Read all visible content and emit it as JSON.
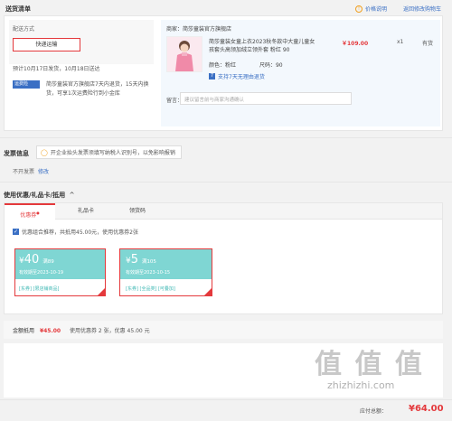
{
  "header": {
    "title": "送货清单",
    "price_help": "价格说明",
    "back_cart": "返回修改购物车"
  },
  "delivery": {
    "label": "配送方式",
    "method_button": "快递运输",
    "schedule": "预计10月17日发货，10月18日送达",
    "badge": "运费险",
    "service_note_line1": "简莎童装官方旗舰店7天内退货，15天内换",
    "service_note_line2": "货，可享1次运费险行到小金库"
  },
  "shop": {
    "label": "商家：简莎童装官方旗舰店",
    "product_name_line1": "简莎童装女童上衣2023秋冬款中大童儿童女",
    "product_name_line2": "孩套头高领加绒立领外套 粉红 90",
    "color_label": "颜色：",
    "color_value": "粉红",
    "size_label": "尺码：",
    "size_value": "90",
    "return_note": "支持7天无理由退货",
    "price": "￥109.00",
    "qty": "x1",
    "stock": "有货",
    "remark_label": "留言：",
    "remark_placeholder": "建议留言前与商家沟通确认"
  },
  "invoice": {
    "title": "发票信息",
    "tip": "开企业抬头发票须填写纳税人识别号，以免影响报销",
    "status": "不开发票",
    "edit": "修改"
  },
  "coupons": {
    "title": "使用优惠/礼品卡/抵用",
    "tabs": [
      "优惠券",
      "礼品卡",
      "领货码"
    ],
    "auto_note": "优惠组合推荐，共抵用45.00元，使用优惠券2张",
    "items": [
      {
        "symbol": "¥",
        "amount": "40",
        "condition": "满89",
        "expiry": "有效期至2023-10-19",
        "tags": "[东券]  [限店铺商品]"
      },
      {
        "symbol": "¥",
        "amount": "5",
        "condition": "满105",
        "expiry": "有效期至2023-10-15",
        "tags": "[东券]  [全品类]  [可叠加]"
      }
    ]
  },
  "summary": {
    "label": "金额抵用",
    "amount": "¥45.00",
    "detail": "使用优惠券 2 张，优惠 45.00 元"
  },
  "footer": {
    "total_label": "应付总额：",
    "total": "¥64.00",
    "watermark": "值 值 值",
    "watermark_url": "zhizhizhi.com"
  },
  "colors": {
    "accent": "#e4393c",
    "coupon": "#7dd3d1",
    "link": "#3a6fc4"
  }
}
